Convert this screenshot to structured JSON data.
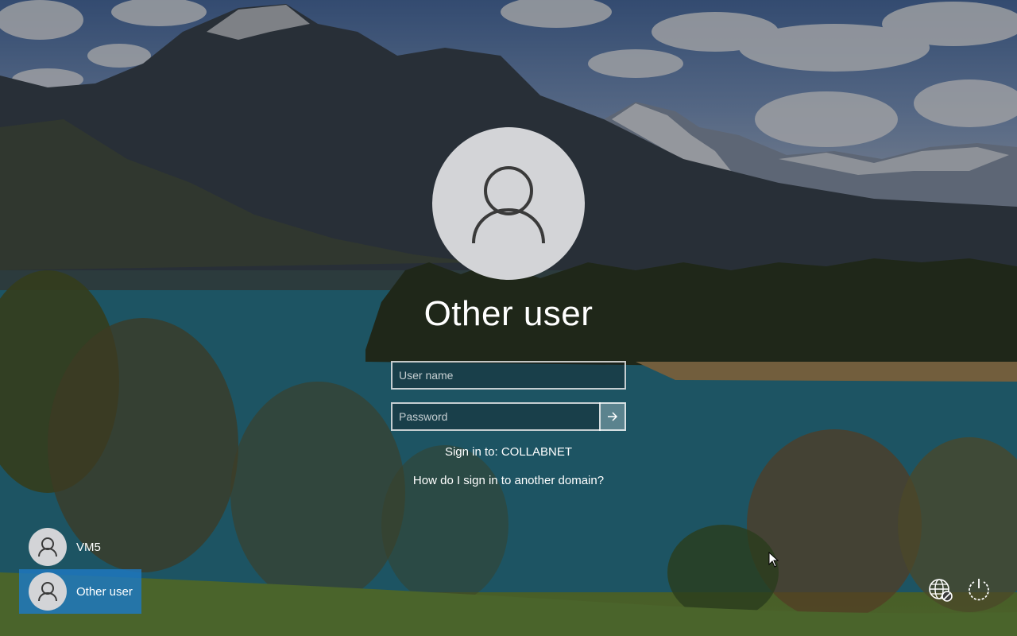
{
  "login": {
    "user_title": "Other user",
    "username_placeholder": "User name",
    "password_placeholder": "Password",
    "submit_icon": "arrow-right-icon",
    "sign_in_to": "Sign in to: COLLABNET",
    "help_link": "How do I sign in to another domain?"
  },
  "users": [
    {
      "label": "VM5",
      "icon": "user-avatar-icon",
      "selected": false
    },
    {
      "label": "Other user",
      "icon": "user-avatar-icon",
      "selected": true
    }
  ],
  "corner": {
    "network_icon": "network-globe-icon",
    "power_icon": "power-icon"
  },
  "colors": {
    "selected_tile": "#1e78be",
    "avatar_bg": "#d3d4d7"
  }
}
